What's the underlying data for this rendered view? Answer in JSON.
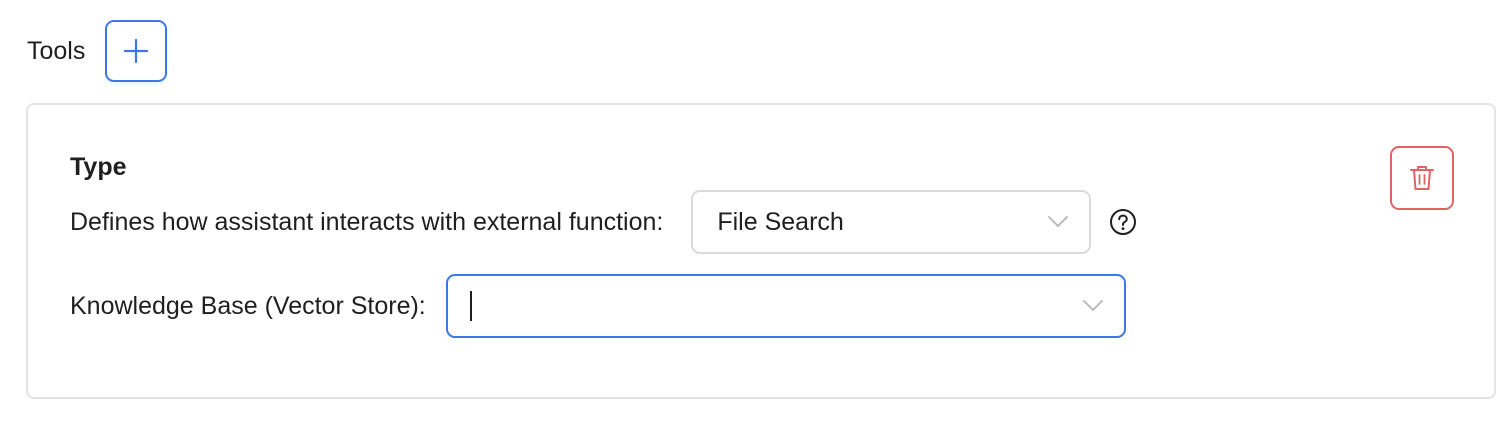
{
  "tools": {
    "label": "Tools",
    "add_icon": "plus-icon"
  },
  "tool_card": {
    "type_heading": "Type",
    "type_field": {
      "label": "Defines how assistant interacts with external function:",
      "selected": "File Search",
      "chevron_icon": "chevron-down-icon",
      "help_icon": "question-circle-icon"
    },
    "knowledge_base_field": {
      "label": "Knowledge Base (Vector Store):",
      "value": "",
      "chevron_icon": "chevron-down-icon"
    },
    "delete_icon": "trash-icon"
  },
  "colors": {
    "primary": "#3b78e7",
    "danger": "#e06464",
    "border": "#dadada",
    "text": "#1f1f1f"
  }
}
